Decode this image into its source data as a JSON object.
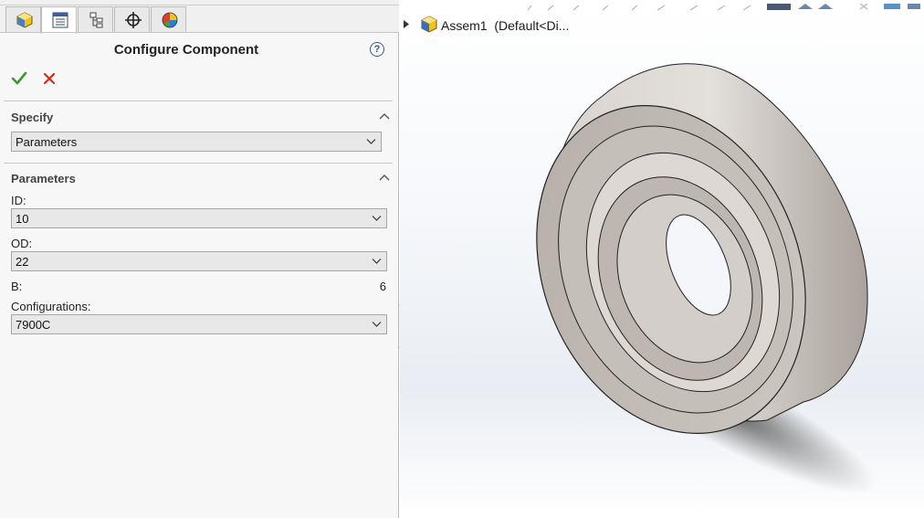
{
  "property_manager": {
    "title": "Configure Component",
    "help_symbol": "?",
    "tabs": [
      {
        "name": "featuremanager-tab",
        "icon": "featuremanager-icon"
      },
      {
        "name": "propertymanager-tab",
        "icon": "propertymanager-icon",
        "active": true
      },
      {
        "name": "configurationmanager-tab",
        "icon": "configurationmanager-icon"
      },
      {
        "name": "dimxpertmanager-tab",
        "icon": "dimxpert-icon"
      },
      {
        "name": "displaymanager-tab",
        "icon": "displaymanager-icon"
      }
    ],
    "specify": {
      "title": "Specify",
      "selected": "Parameters"
    },
    "parameters": {
      "title": "Parameters",
      "id_label": "ID:",
      "id_value": "10",
      "od_label": "OD:",
      "od_value": "22",
      "b_label": "B:",
      "b_value": "6",
      "configurations_label": "Configurations:",
      "configurations_value": "7900C"
    }
  },
  "graphics_area": {
    "tree_root_label": "Assem1  (Default<Di..."
  },
  "colors": {
    "ok_green": "#3a9a2e",
    "cancel_red": "#d42a1e",
    "panel_bg": "#f7f7f7",
    "bearing_gray": "#cdc7c2"
  }
}
